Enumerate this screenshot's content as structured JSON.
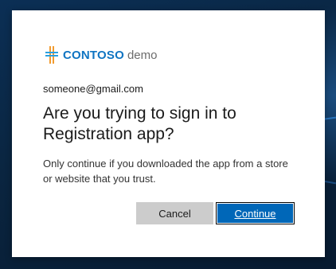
{
  "brand": {
    "logo_icon": "cross-logo-icon",
    "name": "CONTOSO",
    "suffix": "demo",
    "color": "#0f74c2"
  },
  "account": {
    "email": "someone@gmail.com"
  },
  "prompt": {
    "title": "Are you trying to sign in to Registration app?",
    "description": "Only continue if you downloaded the app from a store or website that you trust."
  },
  "actions": {
    "cancel_label": "Cancel",
    "continue_label": "Continue",
    "primary_color": "#0067b8"
  }
}
